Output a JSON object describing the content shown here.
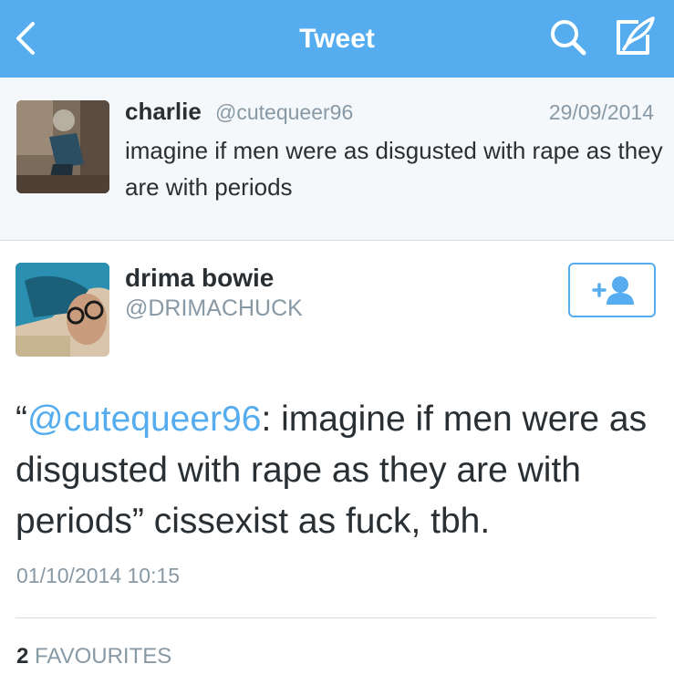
{
  "nav": {
    "title": "Tweet",
    "icons": {
      "back": "chevron-left-icon",
      "search": "search-icon",
      "compose": "compose-icon"
    },
    "background_color": "#55acee"
  },
  "quoted_tweet": {
    "name": "charlie",
    "handle": "@cutequeer96",
    "date": "29/09/2014",
    "text": "imagine if men were as disgusted with rape as they are with periods"
  },
  "tweet": {
    "author_name": "drima bowie",
    "author_handle": "@DRIMACHUCK",
    "follow_icon": "follow-user-icon",
    "text_open_quote": "“",
    "text_mention": "@cutequeer96",
    "text_rest": ": imagine if men were as disgusted with rape as they are with periods” cissexist as fuck, tbh.",
    "timestamp": "01/10/2014 10:15",
    "favourites_count": "2",
    "favourites_label": "FAVOURITES"
  },
  "colors": {
    "accent": "#55acee",
    "muted": "#8899a6",
    "text": "#292f33"
  }
}
